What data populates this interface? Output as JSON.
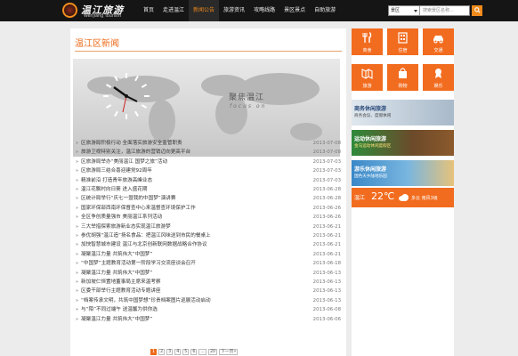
{
  "header": {
    "logo_cn": "温江旅游",
    "logo_en": "Wenjiang Tourism",
    "nav": [
      "首页",
      "走进温江",
      "新闻公告",
      "旅游资讯",
      "攻略线路",
      "景区景点",
      "自助旅游"
    ],
    "active_nav": 2,
    "search": {
      "scope": "景区",
      "placeholder": "搜索景区名称..."
    }
  },
  "main": {
    "title": "温江区新闻",
    "banner": {
      "title": "聚焦温江",
      "subtitle": "focus on"
    },
    "news": [
      {
        "title": "区旅游局积极行动 全面落实旅游安全监管职责",
        "date": "2013-07-08"
      },
      {
        "title": "旅游卫视特别关注，温江旅游的营销迈向更高平台",
        "date": "2013-07-08"
      },
      {
        "title": "区旅游局举办“美丽温江 国梦之旅”活动",
        "date": "2013-07-03"
      },
      {
        "title": "区旅游局三结合喜迎建党92周年",
        "date": "2013-07-03"
      },
      {
        "title": "精准前沿 打造青年旅游高峰业态",
        "date": "2013-07-03"
      },
      {
        "title": "温江花飘村向日葵 进入盛花期",
        "date": "2013-06-28"
      },
      {
        "title": "区统计局举行“庆七一暨我的中国梦”演讲赛",
        "date": "2013-06-28"
      },
      {
        "title": "国家环保部西南环保督查中心来温督查环境保护工作",
        "date": "2013-06-26"
      },
      {
        "title": "全区争创质量强市 美丽温江系列活动",
        "date": "2013-06-26"
      },
      {
        "title": "三大举措探索旅游新业态实现温江旅游梦",
        "date": "2013-06-21"
      },
      {
        "title": "参优胡强“温江造”扬名食品：把温江风味送到市民的餐桌上",
        "date": "2013-06-21"
      },
      {
        "title": "加快智慧城市建设 温江与北京创新联网数据战略合作协议",
        "date": "2013-06-21"
      },
      {
        "title": "凝聚温江力量 共筑伟大“中国梦”",
        "date": "2013-06-21"
      },
      {
        "title": "“中国梦”主题教育活动第一阶段学习交流座谈会召开",
        "date": "2013-06-18"
      },
      {
        "title": "凝聚温江力量 共筑伟大“中国梦”",
        "date": "2013-06-13"
      },
      {
        "title": "新加坡仁恒置地董事局主席来温考察",
        "date": "2013-06-13"
      },
      {
        "title": "区委干部举行主题教育活动专题讲座",
        "date": "2013-06-13"
      },
      {
        "title": "“档案传承文明，共筑中国梦想”珍贵档案图片巡展活动启动",
        "date": "2013-06-13"
      },
      {
        "title": "与“陌”不同过端午 送温馨为供你选",
        "date": "2013-06-08"
      },
      {
        "title": "凝聚温江力量 共筑伟大“中国梦”",
        "date": "2013-06-06"
      }
    ],
    "pager": [
      "1",
      "2",
      "3",
      "4",
      "5",
      "6",
      "...",
      "20",
      "下一页»"
    ],
    "current_page": 0
  },
  "sidebar": {
    "tiles": [
      {
        "label": "商食",
        "icon": "fork-knife-icon"
      },
      {
        "label": "住宿",
        "icon": "building-icon"
      },
      {
        "label": "交通",
        "icon": "car-icon"
      },
      {
        "label": "旅游",
        "icon": "map-icon"
      },
      {
        "label": "购物",
        "icon": "bag-icon"
      },
      {
        "label": "娱乐",
        "icon": "ribbon-icon"
      }
    ],
    "promos": [
      {
        "title": "商务休闲旅游",
        "sub": "商务会议、度假休闲"
      },
      {
        "title": "运动休闲旅游",
        "sub": "金马运动休闲度假区"
      },
      {
        "title": "游乐休闲旅游",
        "sub": "国色天乡陆地乐园"
      }
    ],
    "weather": {
      "city": "温江",
      "temp": "22℃",
      "cond": "多云 南风3级"
    },
    "colors": {
      "accent": "#f26c1f"
    }
  }
}
